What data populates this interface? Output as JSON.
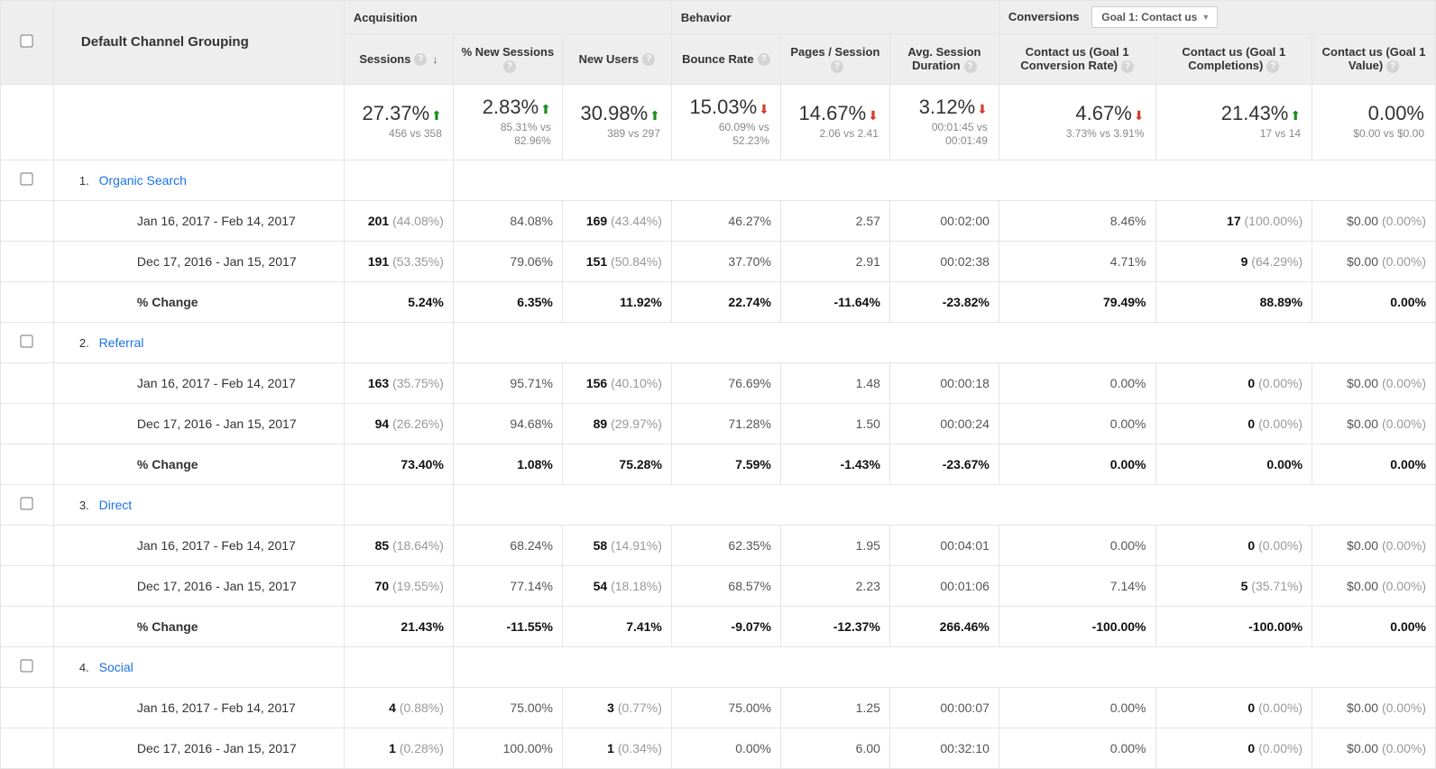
{
  "dimension_header": "Default Channel Grouping",
  "groups": {
    "acquisition": "Acquisition",
    "behavior": "Behavior",
    "conversions": "Conversions"
  },
  "conversion_selector": "Goal 1: Contact us",
  "metrics": [
    {
      "key": "sessions",
      "label": "Sessions",
      "sort": true
    },
    {
      "key": "new_sessions_pct",
      "label": "% New Sessions"
    },
    {
      "key": "new_users",
      "label": "New Users"
    },
    {
      "key": "bounce_rate",
      "label": "Bounce Rate"
    },
    {
      "key": "pages_session",
      "label": "Pages / Session"
    },
    {
      "key": "avg_duration",
      "label": "Avg. Session Duration"
    },
    {
      "key": "goal1_rate",
      "label": "Contact us (Goal 1 Conversion Rate)"
    },
    {
      "key": "goal1_completions",
      "label": "Contact us (Goal 1 Completions)"
    },
    {
      "key": "goal1_value",
      "label": "Contact us (Goal 1 Value)"
    }
  ],
  "summary": [
    {
      "pct": "27.37%",
      "dir": "up",
      "sub": "456 vs 358"
    },
    {
      "pct": "2.83%",
      "dir": "up",
      "sub": "85.31% vs 82.96%"
    },
    {
      "pct": "30.98%",
      "dir": "up",
      "sub": "389 vs 297"
    },
    {
      "pct": "15.03%",
      "dir": "down",
      "sub": "60.09% vs 52.23%"
    },
    {
      "pct": "14.67%",
      "dir": "down",
      "sub": "2.06 vs 2.41"
    },
    {
      "pct": "3.12%",
      "dir": "down",
      "sub": "00:01:45 vs 00:01:49"
    },
    {
      "pct": "4.67%",
      "dir": "down",
      "sub": "3.73% vs 3.91%"
    },
    {
      "pct": "21.43%",
      "dir": "up",
      "sub": "17 vs 14"
    },
    {
      "pct": "0.00%",
      "dir": "",
      "sub": "$0.00 vs $0.00"
    }
  ],
  "date_a": "Jan 16, 2017 - Feb 14, 2017",
  "date_b": "Dec 17, 2016 - Jan 15, 2017",
  "change_label": "% Change",
  "channels": [
    {
      "idx": "1.",
      "name": "Organic Search",
      "a": [
        {
          "b": "201",
          "p": "(44.08%)"
        },
        {
          "t": "84.08%"
        },
        {
          "b": "169",
          "p": "(43.44%)"
        },
        {
          "t": "46.27%"
        },
        {
          "t": "2.57"
        },
        {
          "t": "00:02:00"
        },
        {
          "t": "8.46%"
        },
        {
          "b": "17",
          "p": "(100.00%)"
        },
        {
          "t": "$0.00",
          "p": "(0.00%)"
        }
      ],
      "b": [
        {
          "b": "191",
          "p": "(53.35%)"
        },
        {
          "t": "79.06%"
        },
        {
          "b": "151",
          "p": "(50.84%)"
        },
        {
          "t": "37.70%"
        },
        {
          "t": "2.91"
        },
        {
          "t": "00:02:38"
        },
        {
          "t": "4.71%"
        },
        {
          "b": "9",
          "p": "(64.29%)"
        },
        {
          "t": "$0.00",
          "p": "(0.00%)"
        }
      ],
      "c": [
        "5.24%",
        "6.35%",
        "11.92%",
        "22.74%",
        "-11.64%",
        "-23.82%",
        "79.49%",
        "88.89%",
        "0.00%"
      ]
    },
    {
      "idx": "2.",
      "name": "Referral",
      "a": [
        {
          "b": "163",
          "p": "(35.75%)"
        },
        {
          "t": "95.71%"
        },
        {
          "b": "156",
          "p": "(40.10%)"
        },
        {
          "t": "76.69%"
        },
        {
          "t": "1.48"
        },
        {
          "t": "00:00:18"
        },
        {
          "t": "0.00%"
        },
        {
          "b": "0",
          "p": "(0.00%)"
        },
        {
          "t": "$0.00",
          "p": "(0.00%)"
        }
      ],
      "b": [
        {
          "b": "94",
          "p": "(26.26%)"
        },
        {
          "t": "94.68%"
        },
        {
          "b": "89",
          "p": "(29.97%)"
        },
        {
          "t": "71.28%"
        },
        {
          "t": "1.50"
        },
        {
          "t": "00:00:24"
        },
        {
          "t": "0.00%"
        },
        {
          "b": "0",
          "p": "(0.00%)"
        },
        {
          "t": "$0.00",
          "p": "(0.00%)"
        }
      ],
      "c": [
        "73.40%",
        "1.08%",
        "75.28%",
        "7.59%",
        "-1.43%",
        "-23.67%",
        "0.00%",
        "0.00%",
        "0.00%"
      ]
    },
    {
      "idx": "3.",
      "name": "Direct",
      "a": [
        {
          "b": "85",
          "p": "(18.64%)"
        },
        {
          "t": "68.24%"
        },
        {
          "b": "58",
          "p": "(14.91%)"
        },
        {
          "t": "62.35%"
        },
        {
          "t": "1.95"
        },
        {
          "t": "00:04:01"
        },
        {
          "t": "0.00%"
        },
        {
          "b": "0",
          "p": "(0.00%)"
        },
        {
          "t": "$0.00",
          "p": "(0.00%)"
        }
      ],
      "b": [
        {
          "b": "70",
          "p": "(19.55%)"
        },
        {
          "t": "77.14%"
        },
        {
          "b": "54",
          "p": "(18.18%)"
        },
        {
          "t": "68.57%"
        },
        {
          "t": "2.23"
        },
        {
          "t": "00:01:06"
        },
        {
          "t": "7.14%"
        },
        {
          "b": "5",
          "p": "(35.71%)"
        },
        {
          "t": "$0.00",
          "p": "(0.00%)"
        }
      ],
      "c": [
        "21.43%",
        "-11.55%",
        "7.41%",
        "-9.07%",
        "-12.37%",
        "266.46%",
        "-100.00%",
        "-100.00%",
        "0.00%"
      ]
    },
    {
      "idx": "4.",
      "name": "Social",
      "a": [
        {
          "b": "4",
          "p": "(0.88%)"
        },
        {
          "t": "75.00%"
        },
        {
          "b": "3",
          "p": "(0.77%)"
        },
        {
          "t": "75.00%"
        },
        {
          "t": "1.25"
        },
        {
          "t": "00:00:07"
        },
        {
          "t": "0.00%"
        },
        {
          "b": "0",
          "p": "(0.00%)"
        },
        {
          "t": "$0.00",
          "p": "(0.00%)"
        }
      ],
      "b": [
        {
          "b": "1",
          "p": "(0.28%)"
        },
        {
          "t": "100.00%"
        },
        {
          "b": "1",
          "p": "(0.34%)"
        },
        {
          "t": "0.00%"
        },
        {
          "t": "6.00"
        },
        {
          "t": "00:32:10"
        },
        {
          "t": "0.00%"
        },
        {
          "b": "0",
          "p": "(0.00%)"
        },
        {
          "t": "$0.00",
          "p": "(0.00%)"
        }
      ],
      "c": null
    }
  ]
}
